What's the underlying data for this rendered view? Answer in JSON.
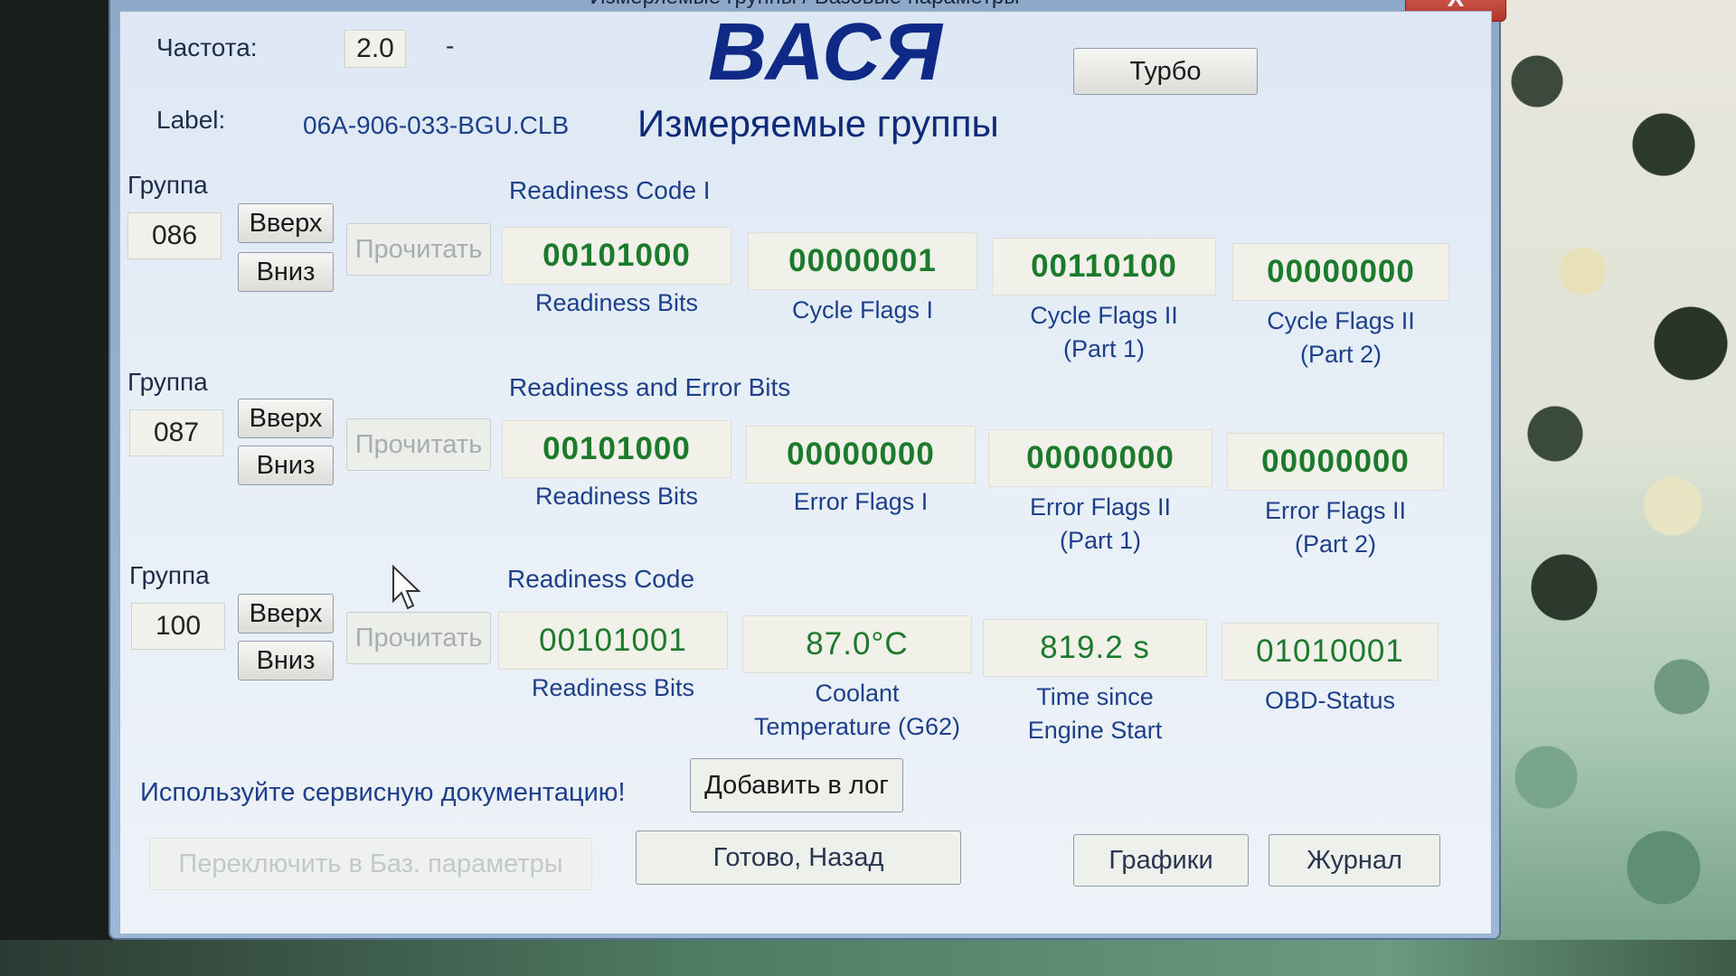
{
  "window": {
    "title": "Измеряемые группы / Базовые параметры",
    "close_label": "X"
  },
  "header": {
    "freq_label": "Частота:",
    "freq_value": "2.0",
    "freq_dash": "-",
    "app_name": "ВАСЯ",
    "turbo_label": "Турбо",
    "label_label": "Label:",
    "label_value": "06A-906-033-BGU.CLB",
    "section_title": "Измеряемые группы"
  },
  "groups": [
    {
      "group_label": "Группа",
      "number": "086",
      "up": "Вверх",
      "down": "Вниз",
      "read": "Прочитать",
      "title": "Readiness Code I",
      "fields": [
        {
          "value": "00101000",
          "caption": "Readiness Bits"
        },
        {
          "value": "00000001",
          "caption": "Cycle Flags I"
        },
        {
          "value": "00110100",
          "caption": "Cycle Flags II\n(Part 1)"
        },
        {
          "value": "00000000",
          "caption": "Cycle Flags II\n(Part 2)"
        }
      ]
    },
    {
      "group_label": "Группа",
      "number": "087",
      "up": "Вверх",
      "down": "Вниз",
      "read": "Прочитать",
      "title": "Readiness and Error Bits",
      "fields": [
        {
          "value": "00101000",
          "caption": "Readiness Bits"
        },
        {
          "value": "00000000",
          "caption": "Error Flags I"
        },
        {
          "value": "00000000",
          "caption": "Error Flags II\n(Part 1)"
        },
        {
          "value": "00000000",
          "caption": "Error Flags II\n(Part 2)"
        }
      ]
    },
    {
      "group_label": "Группа",
      "number": "100",
      "up": "Вверх",
      "down": "Вниз",
      "read": "Прочитать",
      "title": "Readiness Code",
      "fields": [
        {
          "value": "00101001",
          "caption": "Readiness Bits"
        },
        {
          "value": "87.0°C",
          "caption": "Coolant\nTemperature (G62)"
        },
        {
          "value": "819.2 s",
          "caption": "Time since\nEngine Start"
        },
        {
          "value": "01010001",
          "caption": "OBD-Status"
        }
      ]
    }
  ],
  "footer": {
    "hint": "Используйте сервисную документацию!",
    "add_log": "Добавить в лог",
    "switch_basic": "Переключить в Баз. параметры",
    "done_back": "Готово, Назад",
    "graphs": "Графики",
    "journal": "Журнал"
  },
  "colors": {
    "value_text": "#1c7a2c",
    "caption_text": "#1d3f8c",
    "app_title": "#0e2a86"
  }
}
